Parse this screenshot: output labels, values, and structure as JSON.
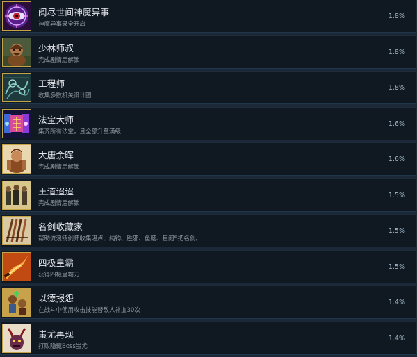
{
  "achievements": [
    {
      "title": "阅尽世间神魔异事",
      "desc": "神魔异事录全开启",
      "pct": "1.8%",
      "icon": "purple-eye-icon"
    },
    {
      "title": "少林师叔",
      "desc": "完成剧情后解锁",
      "pct": "1.8%",
      "icon": "shaolin-monk-icon"
    },
    {
      "title": "工程师",
      "desc": "收集多数机关设计图",
      "pct": "1.8%",
      "icon": "blueprint-icon"
    },
    {
      "title": "法宝大师",
      "desc": "集齐所有法宝，且全部升至满级",
      "pct": "1.6%",
      "icon": "magic-treasure-icon"
    },
    {
      "title": "大唐余晖",
      "desc": "完成剧情后解锁",
      "pct": "1.6%",
      "icon": "tang-warrior-icon"
    },
    {
      "title": "王道迢迢",
      "desc": "完成剧情后解锁",
      "pct": "1.5%",
      "icon": "journey-party-icon"
    },
    {
      "title": "名剑收藏家",
      "desc": "帮助流浪铸剑师收集湛卢、纯钧、胜邪、鱼肠、巨阙5把名剑。",
      "pct": "1.5%",
      "icon": "swords-collection-icon"
    },
    {
      "title": "四极皇霸",
      "desc": "获得四极皇霸刀",
      "pct": "1.5%",
      "icon": "flame-blade-icon"
    },
    {
      "title": "以德报怨",
      "desc": "在战斗中使用攻击技能替敌人补血30次",
      "pct": "1.4%",
      "icon": "healing-battle-icon"
    },
    {
      "title": "蚩尤再现",
      "desc": "打败隐藏Boss蚩尤",
      "pct": "1.4%",
      "icon": "chiyou-demon-icon"
    }
  ]
}
